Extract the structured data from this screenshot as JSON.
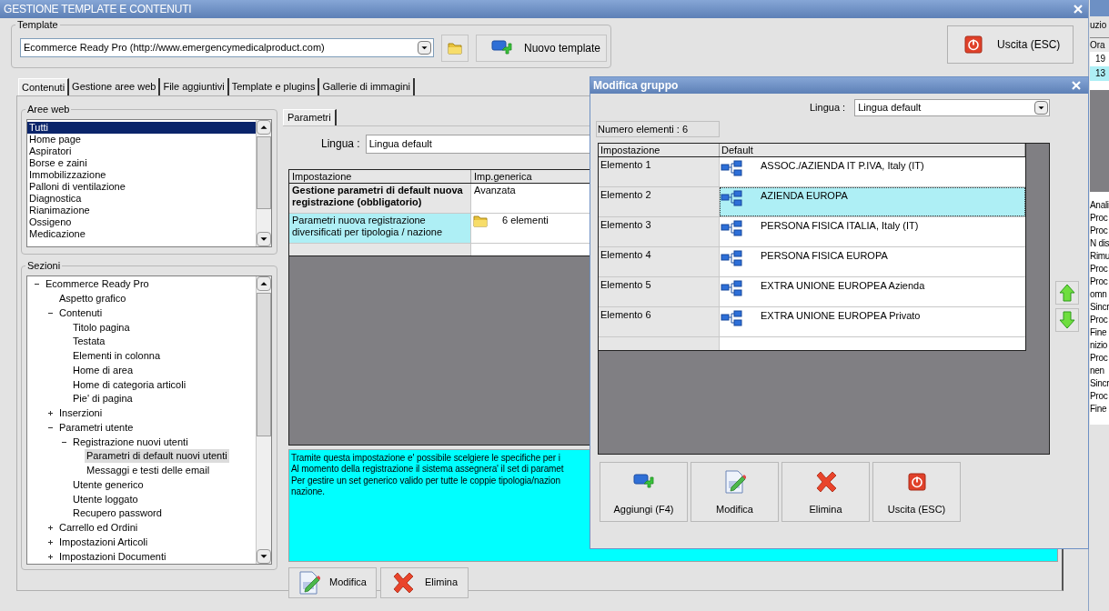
{
  "window": {
    "title": "GESTIONE TEMPLATE E CONTENUTI"
  },
  "template": {
    "legend": "Template",
    "value": "Ecommerce Ready Pro (http://www.emergencymedicalproduct.com)",
    "new_button": "Nuovo template"
  },
  "exit_button": "Uscita (ESC)",
  "tabs": [
    {
      "label": "Contenuti",
      "selected": true
    },
    {
      "label": "Gestione aree web",
      "selected": false
    },
    {
      "label": "File aggiuntivi",
      "selected": false
    },
    {
      "label": "Template e plugins",
      "selected": false
    },
    {
      "label": "Gallerie di immagini",
      "selected": false
    }
  ],
  "aree_web": {
    "legend": "Aree web",
    "items": [
      {
        "label": "Tutti",
        "selected": true
      },
      {
        "label": "Home page",
        "selected": false
      },
      {
        "label": "Aspiratori",
        "selected": false
      },
      {
        "label": "Borse e zaini",
        "selected": false
      },
      {
        "label": "Immobilizzazione",
        "selected": false
      },
      {
        "label": "Palloni di ventilazione",
        "selected": false
      },
      {
        "label": "Diagnostica",
        "selected": false
      },
      {
        "label": "Rianimazione",
        "selected": false
      },
      {
        "label": "Ossigeno",
        "selected": false
      },
      {
        "label": "Medicazione",
        "selected": false
      }
    ]
  },
  "sezioni": {
    "legend": "Sezioni",
    "tree": [
      {
        "label": "Ecommerce Ready Pro",
        "selected": false,
        "expanded": true,
        "children": [
          {
            "label": "Aspetto grafico",
            "selected": false
          },
          {
            "label": "Contenuti",
            "selected": false,
            "expanded": true,
            "children": [
              {
                "label": "Titolo pagina",
                "selected": false
              },
              {
                "label": "Testata",
                "selected": false
              },
              {
                "label": "Elementi in colonna",
                "selected": false
              },
              {
                "label": "Home di area",
                "selected": false
              },
              {
                "label": "Home di categoria articoli",
                "selected": false
              },
              {
                "label": "Pie' di pagina",
                "selected": false
              }
            ]
          },
          {
            "label": "Inserzioni",
            "selected": false,
            "expanded": false
          },
          {
            "label": "Parametri utente",
            "selected": false,
            "expanded": true,
            "children": [
              {
                "label": "Registrazione nuovi utenti",
                "selected": false,
                "expanded": true,
                "children": [
                  {
                    "label": "Parametri di default nuovi utenti",
                    "selected": true
                  },
                  {
                    "label": "Messaggi e testi delle email",
                    "selected": false
                  }
                ]
              },
              {
                "label": "Utente generico",
                "selected": false
              },
              {
                "label": "Utente loggato",
                "selected": false
              },
              {
                "label": "Recupero password",
                "selected": false
              }
            ]
          },
          {
            "label": "Carrello ed Ordini",
            "selected": false,
            "expanded": false
          },
          {
            "label": "Impostazioni Articoli",
            "selected": false,
            "expanded": false
          },
          {
            "label": "Impostazioni Documenti",
            "selected": false,
            "expanded": false
          }
        ]
      }
    ]
  },
  "parametri": {
    "tab": "Parametri",
    "lingua_label": "Lingua :",
    "lingua_value": "Lingua default",
    "columns": [
      "Impostazione",
      "Imp.generica"
    ],
    "rows": [
      {
        "kind": "required",
        "setting": "Gestione parametri di default nuova registrazione (obbligatorio)",
        "value": "Avanzata",
        "selected": false
      },
      {
        "kind": "group",
        "setting": "Parametri nuova registrazione diversificati per tipologia / nazione",
        "value": "6 elementi",
        "selected": true
      }
    ],
    "description": [
      "Tramite questa impostazione e' possibile scelgiere le specifiche per i",
      "Al momento della registrazione il sistema assegnera' il set di paramet",
      "Per gestire un set generico valido per tutte le coppie tipologia/nazion",
      "nazione."
    ],
    "buttons": [
      "Modifica",
      "Elimina"
    ]
  },
  "dialog": {
    "title": "Modifica gruppo",
    "lingua_label": "Lingua :",
    "lingua_value": "Lingua default",
    "count": "Numero elementi : 6",
    "columns": [
      "Impostazione",
      "Default"
    ],
    "rows": [
      {
        "name": "Elemento 1",
        "value": "ASSOC./AZIENDA IT P.IVA, Italy (IT)",
        "selected": false
      },
      {
        "name": "Elemento 2",
        "value": "AZIENDA EUROPA",
        "selected": true
      },
      {
        "name": "Elemento 3",
        "value": "PERSONA FISICA ITALIA, Italy (IT)",
        "selected": false
      },
      {
        "name": "Elemento 4",
        "value": "PERSONA FISICA EUROPA",
        "selected": false
      },
      {
        "name": "Elemento 5",
        "value": "EXTRA UNIONE EUROPEA Azienda",
        "selected": false
      },
      {
        "name": "Elemento 6",
        "value": "EXTRA UNIONE EUROPEA Privato",
        "selected": false
      }
    ],
    "buttons": [
      {
        "kind": "add",
        "label": "Aggiungi (F4)"
      },
      {
        "kind": "edit",
        "label": "Modifica"
      },
      {
        "kind": "delete",
        "label": "Elimina"
      },
      {
        "kind": "exit",
        "label": "Uscita (ESC)"
      }
    ]
  },
  "background_window": {
    "title": "uzio",
    "column": "Ora",
    "cells": [
      {
        "text": "19",
        "selected": false
      },
      {
        "text": "13",
        "selected": true
      }
    ],
    "log": [
      "Anali",
      "Proc",
      "Proc",
      "N dis",
      "Rimu",
      "Proc",
      "Proc",
      "omn",
      "Sincr",
      "Proc",
      "Fine",
      "nizio",
      "Proc",
      "nen",
      "Sincr",
      "Proc",
      "Fine"
    ]
  }
}
